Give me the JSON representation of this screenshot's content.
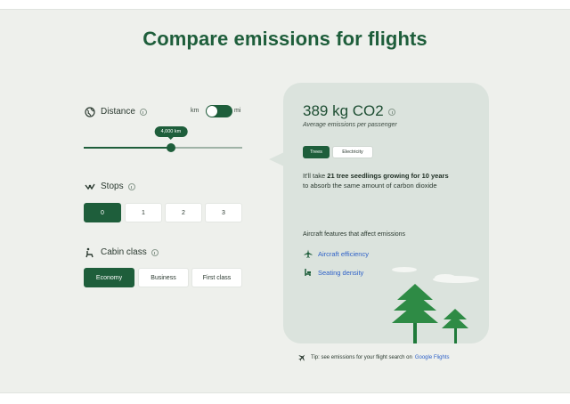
{
  "title": "Compare emissions for flights",
  "colors": {
    "accent": "#1e5e3b",
    "card": "#dbe3dd",
    "link": "#2f62c8",
    "background": "#eef0ec"
  },
  "distance": {
    "label": "Distance",
    "unit_left": "km",
    "unit_right": "mi",
    "toggle_on": true,
    "slider_value_label": "4,000 km",
    "slider_fraction": 0.55
  },
  "stops": {
    "label": "Stops",
    "options": [
      "0",
      "1",
      "2",
      "3"
    ],
    "selected": "0"
  },
  "cabin": {
    "label": "Cabin class",
    "options": [
      "Economy",
      "Business",
      "First class"
    ],
    "selected": "Economy"
  },
  "result": {
    "value": "389 kg CO2",
    "subtitle": "Average emissions per passenger",
    "tabs": [
      "Trees",
      "Electricity"
    ],
    "active_tab": "Trees",
    "fact_prefix": "It'll take",
    "fact_bold1": "21 tree seedlings growing",
    "fact_bold2": "for 10 years",
    "fact_suffix": "to absorb the same amount of carbon dioxide",
    "features_title": "Aircraft features that affect emissions",
    "features": [
      {
        "icon": "airplane-icon",
        "label": "Aircraft efficiency"
      },
      {
        "icon": "seat-icon",
        "label": "Seating density"
      }
    ]
  },
  "footer": {
    "text": "Tip: see emissions for your flight search on",
    "link": "Google Flights"
  }
}
